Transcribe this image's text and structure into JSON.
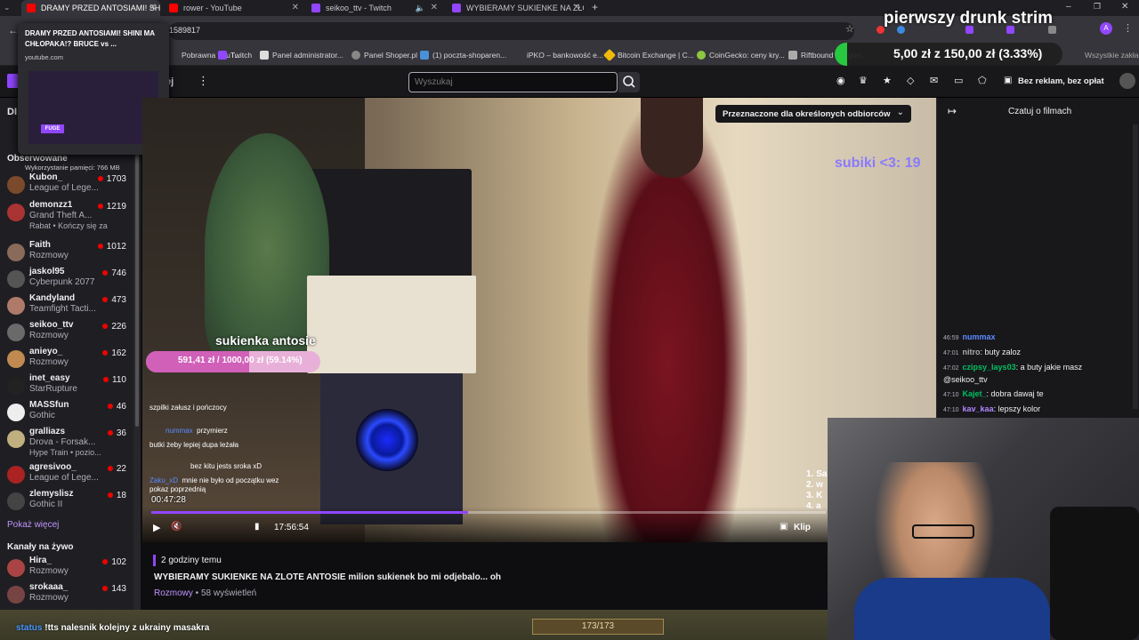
{
  "browser": {
    "tabs": [
      {
        "title": "DRAMY PRZED ANTOSIAMI! SH",
        "color": "#ff0000",
        "active": true
      },
      {
        "title": "rower - YouTube",
        "color": "#ff0000"
      },
      {
        "title": "seikoo_ttv - Twitch",
        "color": "#9146ff"
      },
      {
        "title": "WYBIERAMY SUKIENKE NA ZŁO",
        "color": "#9146ff"
      }
    ],
    "address_tail": "1589817",
    "bookmarks": [
      {
        "label": "Pobrawna YouT...",
        "color": "#ff0000"
      },
      {
        "label": "Twitch",
        "color": "#9146ff"
      },
      {
        "label": "Panel administrator...",
        "color": "#dddddd"
      },
      {
        "label": "Panel Shoper.pl",
        "color": "#888888"
      },
      {
        "label": "(1) poczta-shoparen...",
        "color": "#4a90d9"
      },
      {
        "label": "iPKO – bankowość e...",
        "color": "#1a3a7a"
      },
      {
        "label": "Bitcoin Exchange | C...",
        "color": "#f0b90b"
      },
      {
        "label": "CoinGecko: ceny kry...",
        "color": "#8dc63f"
      },
      {
        "label": "Riftbound League...",
        "color": "#aaaaaa"
      },
      {
        "label": "Wszystkie zakładki",
        "color": "#35353b"
      }
    ],
    "preview": {
      "title": "DRAMY PRZED ANTOSIAMI! SHINI MA CHŁOPAKA!? BRUCE vs ...",
      "domain": "youtube.com",
      "memory": "Wykorzystanie pamięci: 766 MB"
    }
  },
  "overlay_top": {
    "stream_title": "pierwszy drunk strim",
    "donation": "5,00 zł z 150,00 zł (3.33%)",
    "donation_progress": 0.0333
  },
  "twitch_nav": {
    "search_placeholder": "Wyszukaj",
    "ad_free": "Bez reklam, bez opłat",
    "sidebar_header": "Obserwowane",
    "live_header": "Kanały na żywo",
    "show_more": "Pokaż więcej"
  },
  "followed": [
    {
      "name": "Kubon_",
      "game": "League of Lege...",
      "viewers": "1703",
      "color": "#7a4a2a"
    },
    {
      "name": "demonzz1",
      "game": "Grand Theft A...",
      "viewers": "1219",
      "color": "#aa3333",
      "note": "Rabat • Kończy się za"
    },
    {
      "name": "Faith",
      "game": "Rozmowy",
      "viewers": "1012",
      "color": "#8a6a5a"
    },
    {
      "name": "jaskol95",
      "game": "Cyberpunk 2077",
      "viewers": "746",
      "color": "#555555"
    },
    {
      "name": "Kandyland",
      "game": "Teamfight Tacti...",
      "viewers": "473",
      "color": "#b07a6a"
    },
    {
      "name": "seikoo_ttv",
      "game": "Rozmowy",
      "viewers": "226",
      "color": "#6a6a6a"
    },
    {
      "name": "anieyo_",
      "game": "Rozmowy",
      "viewers": "162",
      "color": "#c08a50"
    },
    {
      "name": "inet_easy",
      "game": "StarRupture",
      "viewers": "110",
      "color": "#222222"
    },
    {
      "name": "MASSfun",
      "game": "Gothic",
      "viewers": "46",
      "color": "#eeeeee"
    },
    {
      "name": "gralliazs",
      "game": "Drova - Forsak...",
      "viewers": "36",
      "color": "#c0b080",
      "note": "Hype Train • pozio..."
    },
    {
      "name": "agresivoo_",
      "game": "League of Lege...",
      "viewers": "22",
      "color": "#aa2222"
    },
    {
      "name": "zlemyslisz",
      "game": "Gothic II",
      "viewers": "18",
      "color": "#444444"
    }
  ],
  "live_channels": [
    {
      "name": "Hira_",
      "game": "Rozmowy",
      "viewers": "102",
      "color": "#aa4444"
    },
    {
      "name": "srokaaa_",
      "game": "Rozmowy",
      "viewers": "143",
      "color": "#774444"
    }
  ],
  "video": {
    "audience_badge": "Przeznaczone dla określonych odbiorców",
    "subs_counter": "subiki <3: 19",
    "goal_label": "sukienka antosie",
    "goal_amount": "591,41 zł / 1000,00 zł (59.14%)",
    "goal_progress": 0.5914,
    "stream_time": "00:47:28",
    "player_time": "17:56:54",
    "playback_progress": 0.47,
    "clip": "Klip",
    "inner_chat": [
      {
        "user": "",
        "text": "szpilki załusz i pończocy",
        "color": "#ff4a7a"
      },
      {
        "user": "nummax",
        "text": "przymierz",
        "color": "#5a8aff"
      },
      {
        "user": "",
        "text": "butki żeby lepiej dupa leżała",
        "color": "#ff4a7a"
      },
      {
        "user": "",
        "text": "bez kitu jests sroka xD",
        "color": "#aaaaaa"
      },
      {
        "user": "Zaku_xD",
        "text": "mnie nie było od początku wez pokaz poprzednią",
        "color": "#5a8aff"
      }
    ],
    "ranking": [
      "1. Sa",
      "2. w",
      "3. K",
      "4. a"
    ]
  },
  "chat_header": "Czatuj o filmach",
  "chat": [
    {
      "time": "46:59",
      "user": "nummax",
      "text": "",
      "color": "#5a8aff"
    },
    {
      "time": "47:01",
      "user": "nitro",
      "text": ": buty zaloz",
      "color": "#aaaaaa"
    },
    {
      "time": "47:02",
      "user": "czipsy_lays03",
      "text": ": a buty jakie masz",
      "color": "#00c060"
    },
    {
      "time": "",
      "user": "",
      "text": "@seikoo_ttv",
      "color": "#efeff1"
    },
    {
      "time": "47:10",
      "user": "Kajet_",
      "text": ": dobra dawaj te",
      "color": "#00c060"
    },
    {
      "time": "47:10",
      "user": "kav_kaa",
      "text": ": lepszy kolor",
      "color": "#b084ff"
    }
  ],
  "vod": {
    "age": "2 godziny temu",
    "title": "WYBIERAMY SUKIENKE NA ZLOTE ANTOSIE milion sukienek bo mi odjebalo... oh",
    "category": "Rozmowy",
    "views": "58 wyświetleń"
  },
  "bottom": {
    "ticker": "!tts nalesnik kolejny z ukrainy masakra",
    "ticker_user": "status",
    "hp": "173/173"
  }
}
